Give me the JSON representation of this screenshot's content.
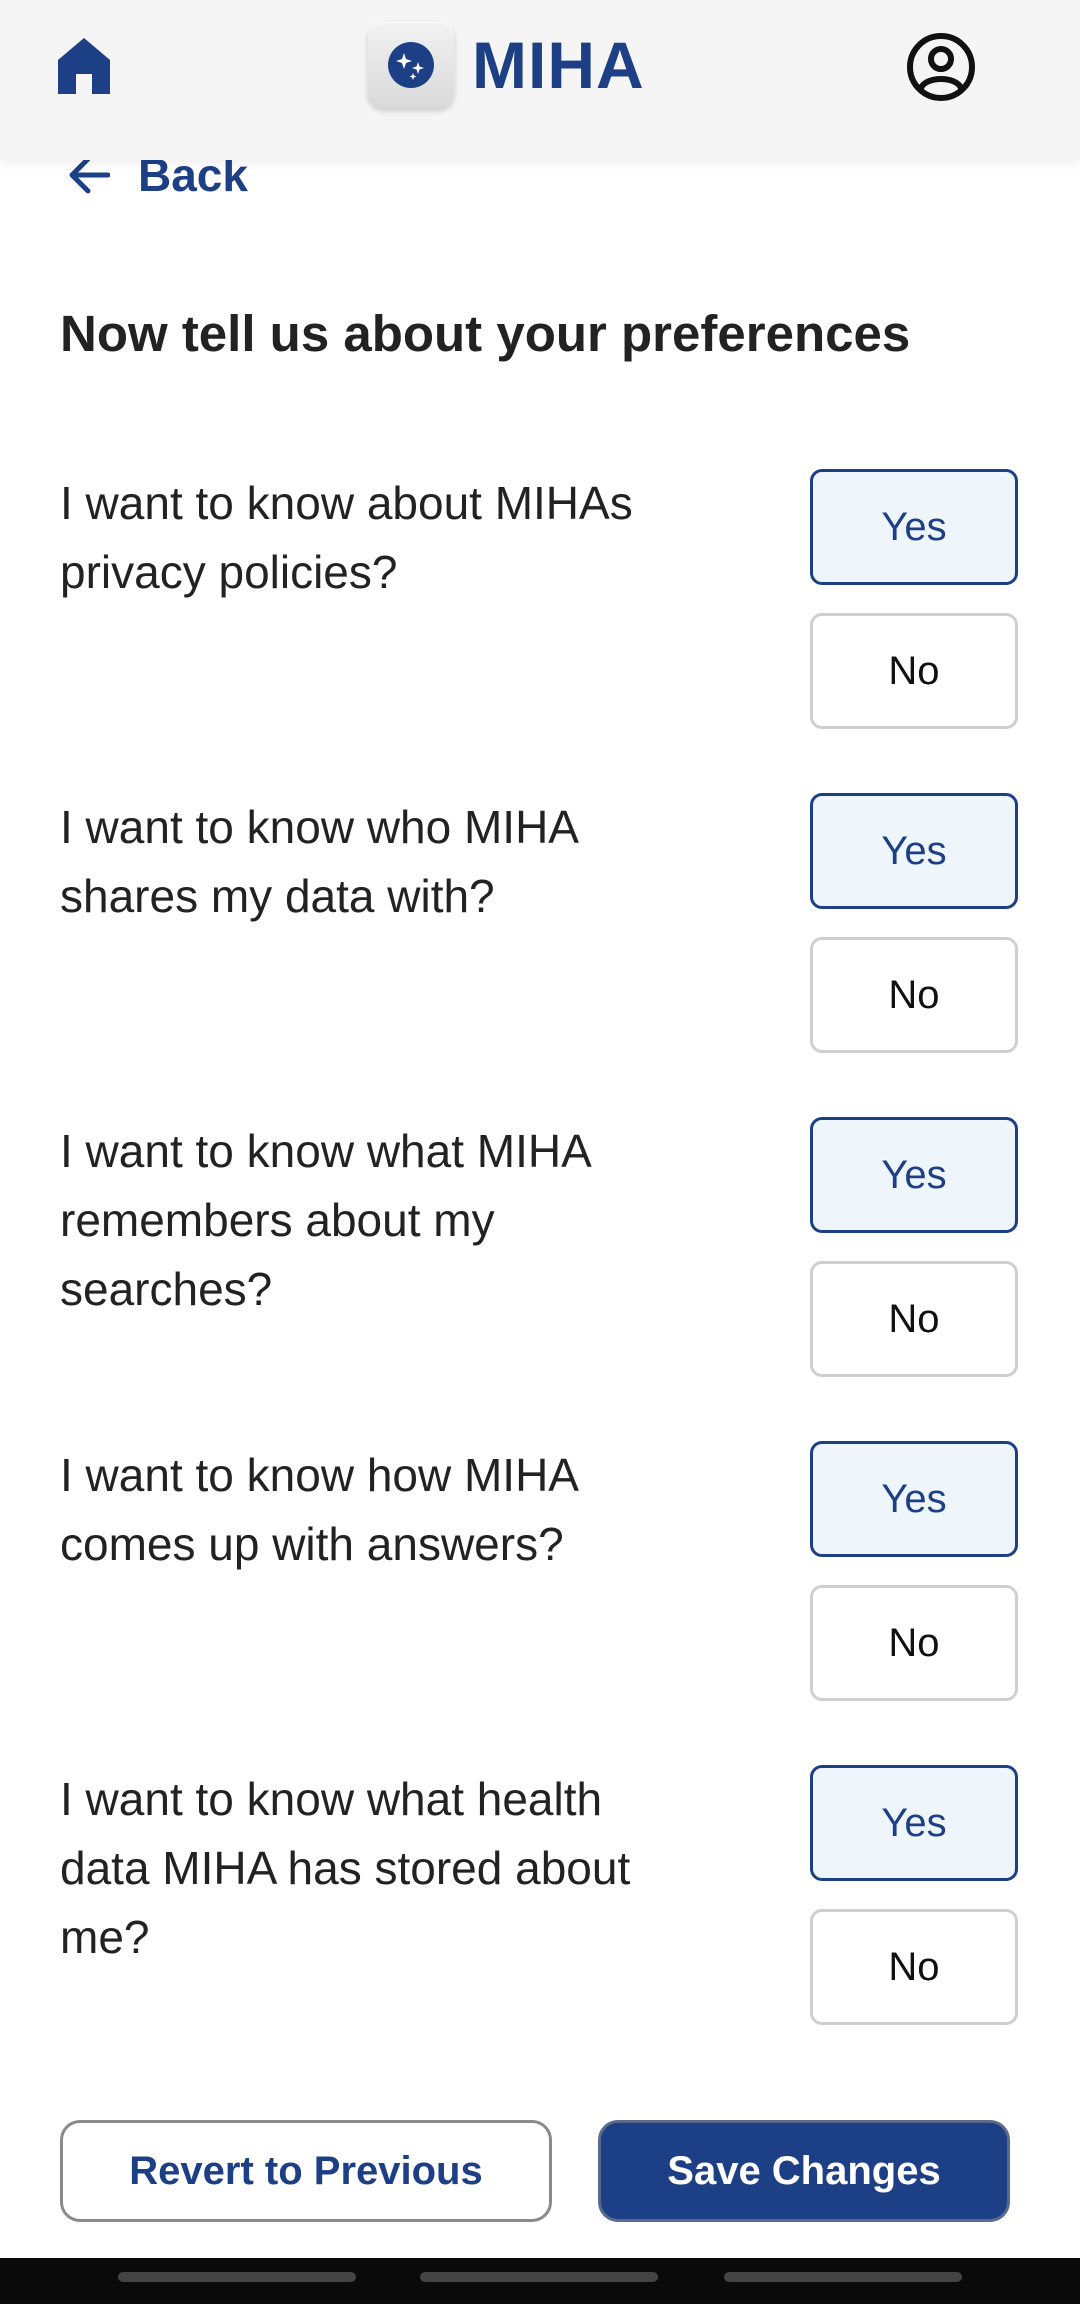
{
  "header": {
    "home_icon": "home-icon",
    "logo_icon": "miha-logo-icon",
    "app_name": "MIHA",
    "profile_icon": "account-circle-icon",
    "brand_color": "#1d3f85"
  },
  "back": {
    "icon": "arrow-left-icon",
    "label": "Back"
  },
  "title": "Now tell us about your preferences",
  "questions": [
    {
      "text": "I want to know about MIHAs privacy policies?",
      "yes": "Yes",
      "no": "No",
      "selected": "Yes"
    },
    {
      "text": "I want to know who MIHA shares my data with?",
      "yes": "Yes",
      "no": "No",
      "selected": "Yes"
    },
    {
      "text": "I want to know what MIHA remembers about my searches?",
      "yes": "Yes",
      "no": "No",
      "selected": "Yes"
    },
    {
      "text": "I want to know how MIHA comes up with answers?",
      "yes": "Yes",
      "no": "No",
      "selected": "Yes"
    },
    {
      "text": "I want to know what health data MIHA has stored about me?",
      "yes": "Yes",
      "no": "No",
      "selected": "Yes"
    }
  ],
  "actions": {
    "revert_label": "Revert to Previous",
    "save_label": "Save Changes"
  }
}
